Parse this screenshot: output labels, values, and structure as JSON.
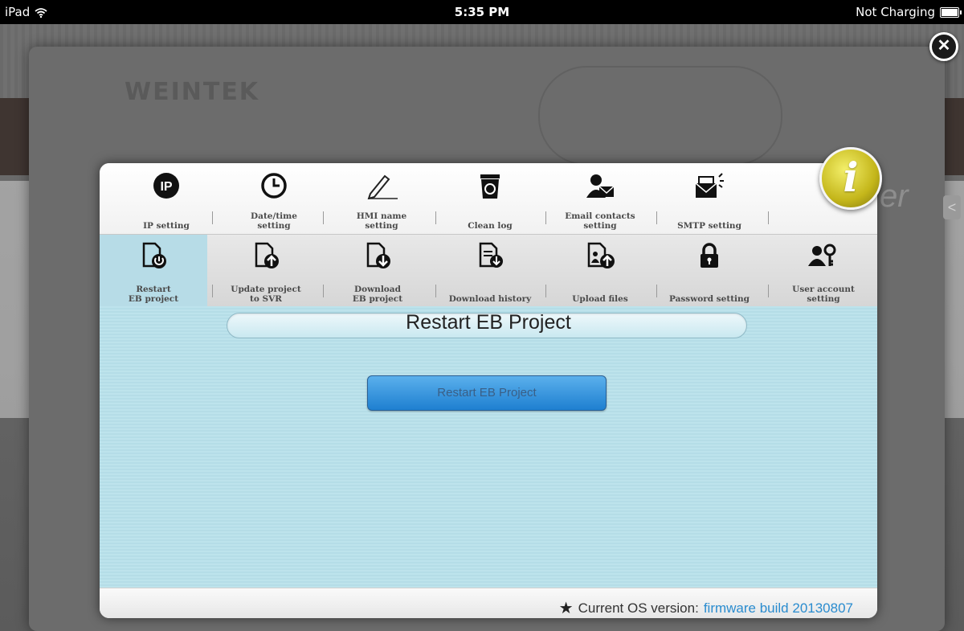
{
  "status_bar": {
    "device": "iPad",
    "time": "5:35 PM",
    "charging": "Not Charging"
  },
  "background": {
    "logo_text": "WEINTEK",
    "partial_text": "er",
    "arrow_glyph": "<"
  },
  "close_button": {
    "glyph": "✕"
  },
  "info_badge": {
    "glyph": "i"
  },
  "nav_row1": [
    {
      "label": "IP setting",
      "icon": "ip-icon"
    },
    {
      "label": "Date/time\nsetting",
      "icon": "clock-icon"
    },
    {
      "label": "HMI name\nsetting",
      "icon": "pen-icon"
    },
    {
      "label": "Clean log",
      "icon": "recycle-bin-icon"
    },
    {
      "label": "Email contacts\nsetting",
      "icon": "email-contacts-icon"
    },
    {
      "label": "SMTP setting",
      "icon": "smtp-mail-icon"
    }
  ],
  "nav_row2": [
    {
      "label": "Restart\nEB project",
      "icon": "restart-document-icon",
      "active": true
    },
    {
      "label": "Update project\nto SVR",
      "icon": "upload-document-icon"
    },
    {
      "label": "Download\nEB project",
      "icon": "download-document-icon"
    },
    {
      "label": "Download history",
      "icon": "download-history-icon"
    },
    {
      "label": "Upload files",
      "icon": "upload-files-icon"
    },
    {
      "label": "Password setting",
      "icon": "lock-icon"
    },
    {
      "label": "User account\nsetting",
      "icon": "user-key-icon"
    }
  ],
  "content": {
    "title": "Restart EB Project",
    "button_label": "Restart EB Project"
  },
  "footer": {
    "prefix": "Current OS version:",
    "build": "firmware build 20130807"
  },
  "colors": {
    "active_tab": "#b7dce7",
    "content_bg": "#bde3ec",
    "button_blue": "#1e7fd0",
    "build_text": "#2a8ccf"
  }
}
